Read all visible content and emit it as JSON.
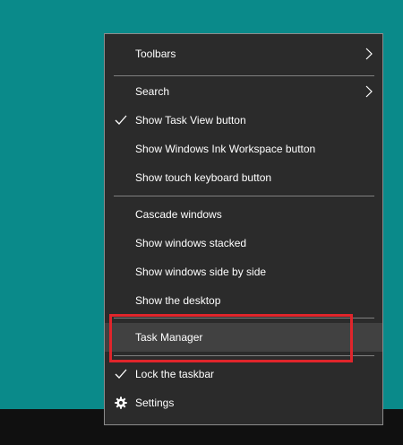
{
  "menu": {
    "items": [
      {
        "id": "toolbars",
        "label": "Toolbars"
      },
      {
        "id": "search",
        "label": "Search"
      },
      {
        "id": "show-task-view",
        "label": "Show Task View button"
      },
      {
        "id": "show-ink-workspace",
        "label": "Show Windows Ink Workspace button"
      },
      {
        "id": "show-touch-keyboard",
        "label": "Show touch keyboard button"
      },
      {
        "id": "cascade",
        "label": "Cascade windows"
      },
      {
        "id": "stacked",
        "label": "Show windows stacked"
      },
      {
        "id": "side-by-side",
        "label": "Show windows side by side"
      },
      {
        "id": "show-desktop",
        "label": "Show the desktop"
      },
      {
        "id": "task-manager",
        "label": "Task Manager"
      },
      {
        "id": "lock-taskbar",
        "label": "Lock the taskbar"
      },
      {
        "id": "settings",
        "label": "Settings"
      }
    ]
  },
  "checked_items": [
    "Show Task View button",
    "Lock the taskbar"
  ],
  "highlighted_item": "Task Manager",
  "colors": {
    "desktop": "#0a8a8a",
    "menu_bg": "#2b2b2b",
    "menu_hover": "#414141",
    "highlight_outline": "#e0252b"
  },
  "icons": {
    "submenu": "chevron-right-icon",
    "checked": "checkmark-icon",
    "settings": "gear-icon"
  }
}
